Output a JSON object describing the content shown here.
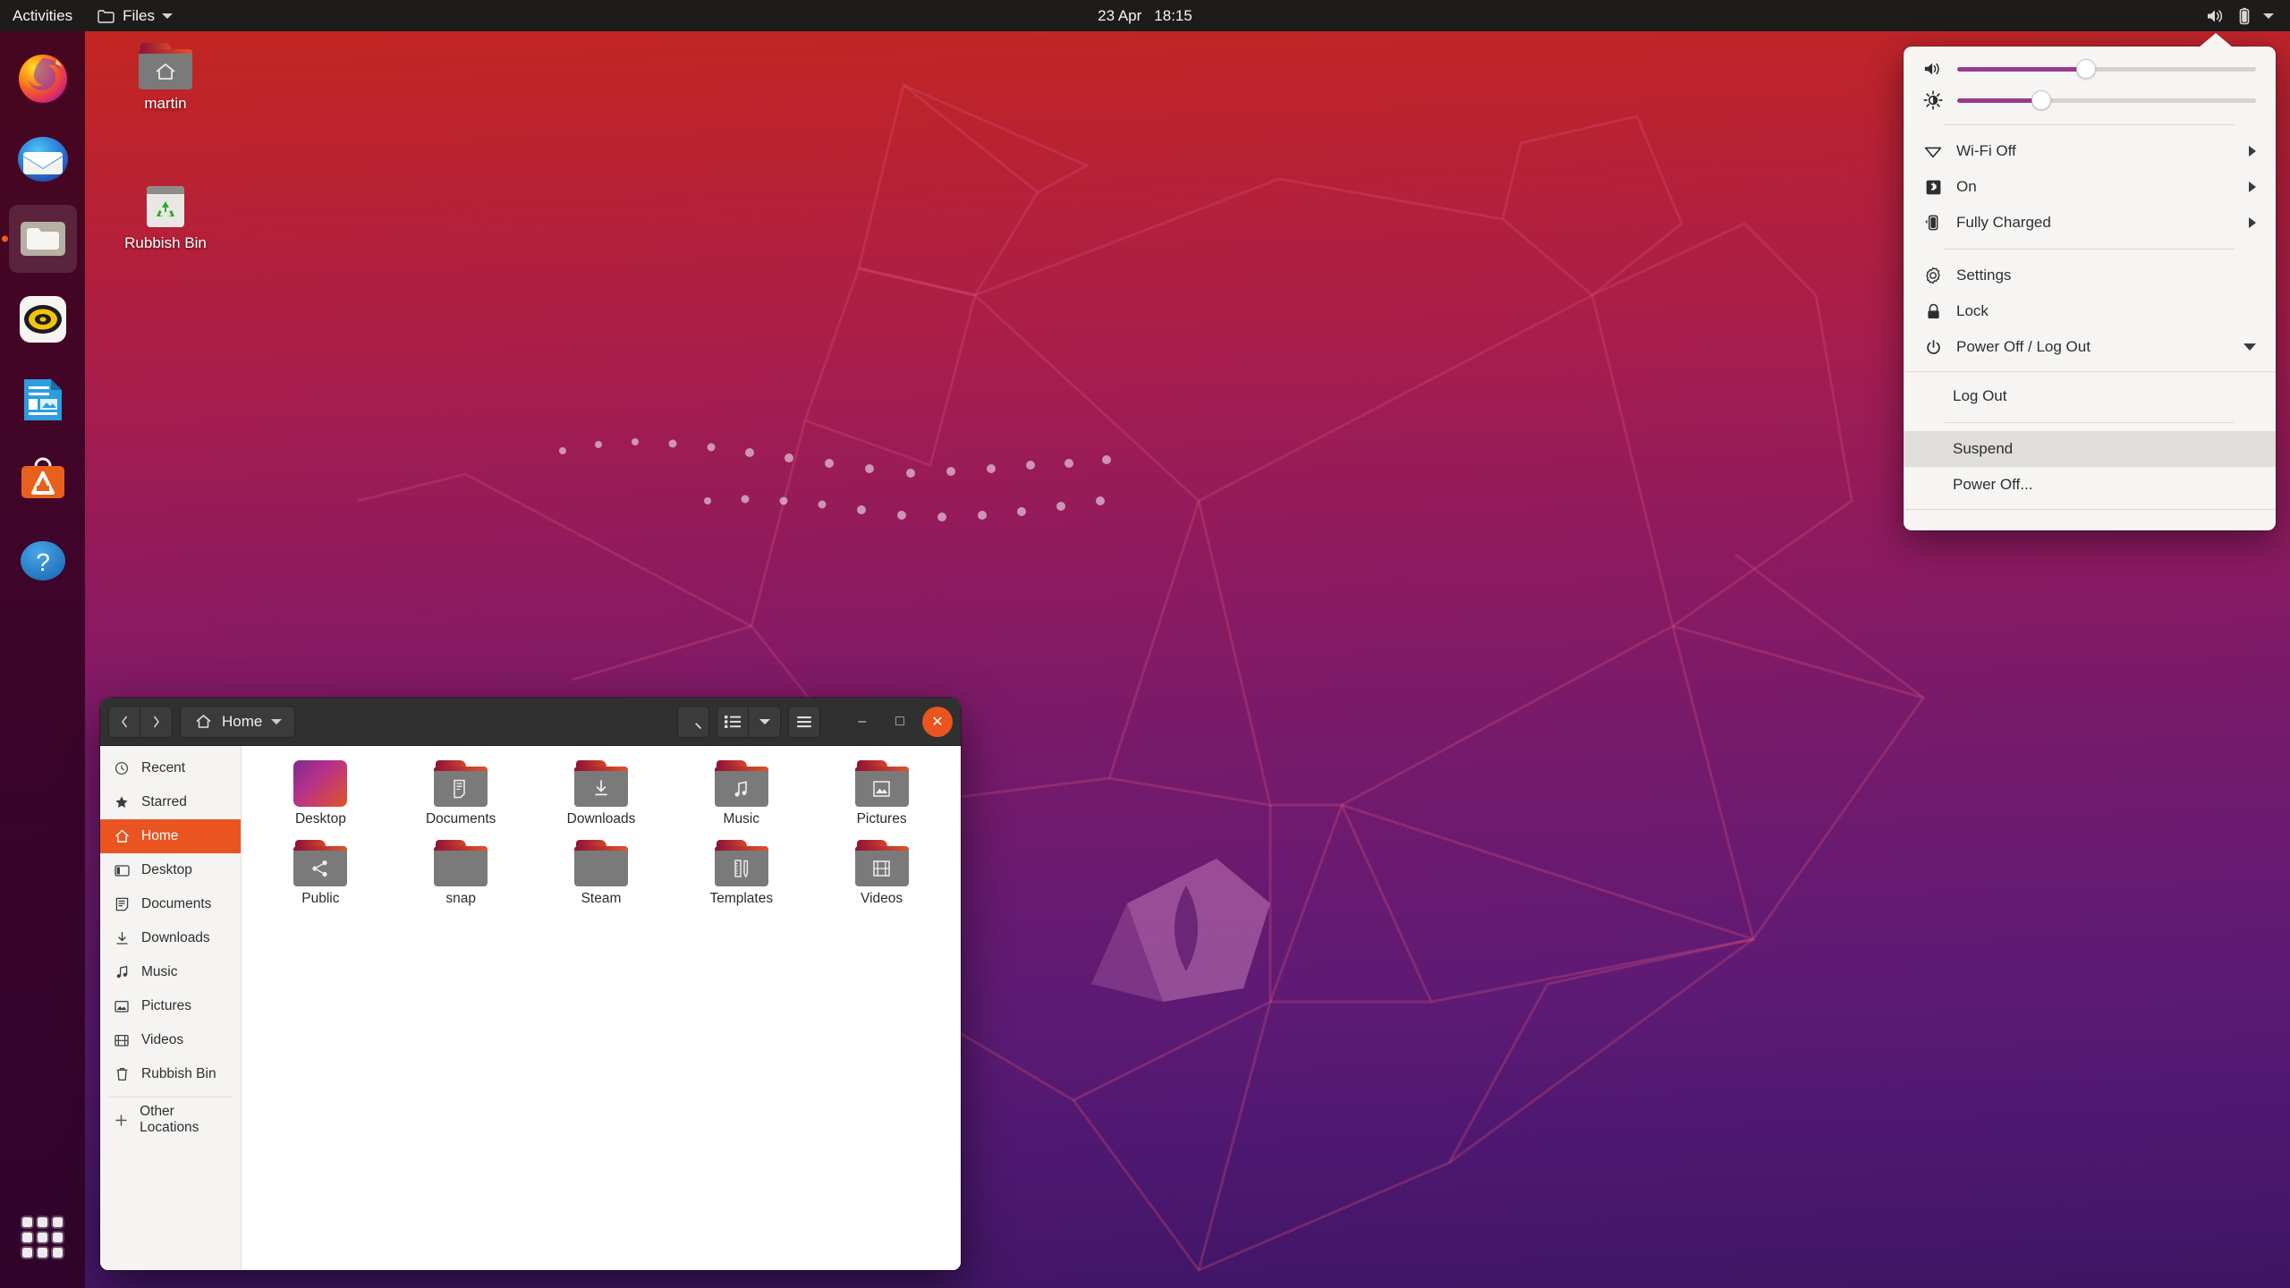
{
  "panel": {
    "activities": "Activities",
    "app_name": "Files",
    "app_icon": "folder-icon",
    "app_caret": "chevron-down-icon",
    "clock_date": "23 Apr",
    "clock_time": "18:15",
    "status_icons": [
      "volume-icon",
      "battery-icon",
      "chevron-down-icon"
    ]
  },
  "dock": {
    "items": [
      {
        "name": "firefox",
        "label": "Firefox",
        "active": false
      },
      {
        "name": "thunderbird",
        "label": "Thunderbird Mail",
        "active": false
      },
      {
        "name": "files",
        "label": "Files",
        "active": true
      },
      {
        "name": "rhythmbox",
        "label": "Rhythmbox",
        "active": false
      },
      {
        "name": "libreoffice-writer",
        "label": "LibreOffice Writer",
        "active": false
      },
      {
        "name": "ubuntu-software",
        "label": "Ubuntu Software",
        "active": false
      },
      {
        "name": "help",
        "label": "Help",
        "active": false
      }
    ],
    "show_apps_label": "Show Applications"
  },
  "desktop_icons": [
    {
      "label": "martin",
      "icon": "home-folder-icon"
    },
    {
      "label": "Rubbish Bin",
      "icon": "trash-icon"
    }
  ],
  "filemanager": {
    "back_icon": "chevron-left-icon",
    "forward_icon": "chevron-right-icon",
    "path_label": "Home",
    "path_icon": "home-icon",
    "path_caret": "chevron-down-icon",
    "search_icon": "search-icon",
    "list_view_icon": "list-view-icon",
    "view_caret": "chevron-down-icon",
    "menu_icon": "hamburger-menu-icon",
    "minimize_label": "–",
    "maximize_label": "□",
    "close_label": "✕",
    "sidebar": [
      {
        "label": "Recent",
        "icon": "clock-icon",
        "selected": false
      },
      {
        "label": "Starred",
        "icon": "star-icon",
        "selected": false
      },
      {
        "label": "Home",
        "icon": "home-icon",
        "selected": true
      },
      {
        "label": "Desktop",
        "icon": "desktop-icon",
        "selected": false
      },
      {
        "label": "Documents",
        "icon": "document-icon",
        "selected": false
      },
      {
        "label": "Downloads",
        "icon": "download-icon",
        "selected": false
      },
      {
        "label": "Music",
        "icon": "music-note-icon",
        "selected": false
      },
      {
        "label": "Pictures",
        "icon": "image-icon",
        "selected": false
      },
      {
        "label": "Videos",
        "icon": "film-icon",
        "selected": false
      },
      {
        "label": "Rubbish Bin",
        "icon": "trash-icon",
        "selected": false
      }
    ],
    "other_locations": {
      "label": "Other Locations",
      "icon": "plus-icon"
    },
    "files": [
      {
        "label": "Desktop",
        "icon": "wallpaper-folder-icon"
      },
      {
        "label": "Documents",
        "icon": "document-folder-icon"
      },
      {
        "label": "Downloads",
        "icon": "download-folder-icon"
      },
      {
        "label": "Music",
        "icon": "music-folder-icon"
      },
      {
        "label": "Pictures",
        "icon": "pictures-folder-icon"
      },
      {
        "label": "Public",
        "icon": "share-folder-icon"
      },
      {
        "label": "snap",
        "icon": "plain-folder-icon"
      },
      {
        "label": "Steam",
        "icon": "plain-folder-icon"
      },
      {
        "label": "Templates",
        "icon": "templates-folder-icon"
      },
      {
        "label": "Videos",
        "icon": "video-folder-icon"
      }
    ]
  },
  "system_menu": {
    "volume": {
      "icon": "volume-icon",
      "percent": 43
    },
    "brightness": {
      "icon": "brightness-icon",
      "percent": 28
    },
    "rows": [
      {
        "label": "Wi-Fi Off",
        "icon": "wifi-icon",
        "expandable": true
      },
      {
        "label": "On",
        "icon": "bluetooth-icon",
        "expandable": true
      },
      {
        "label": "Fully Charged",
        "icon": "battery-icon",
        "expandable": true
      }
    ],
    "actions": [
      {
        "label": "Settings",
        "icon": "gear-icon"
      },
      {
        "label": "Lock",
        "icon": "lock-icon"
      }
    ],
    "power": {
      "label": "Power Off / Log Out",
      "icon": "power-icon",
      "expanded": true
    },
    "power_items": [
      {
        "label": "Log Out",
        "hover": false,
        "separator_after": true
      },
      {
        "label": "Suspend",
        "hover": true,
        "separator_after": false
      },
      {
        "label": "Power Off...",
        "hover": false,
        "separator_after": false
      }
    ]
  },
  "colors": {
    "accent_orange": "#e95420",
    "slider_purple": "#993a8f",
    "panel_dark": "#1e1c1a",
    "menu_bg": "#f6f5f4"
  }
}
